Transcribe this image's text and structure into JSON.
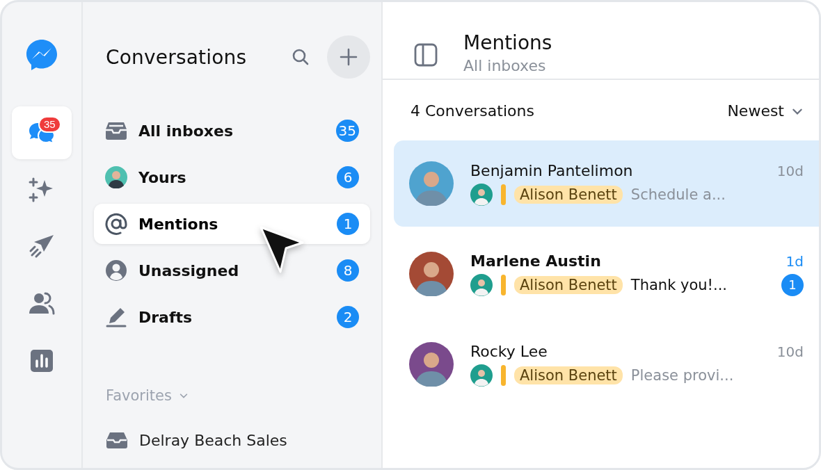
{
  "rail": {
    "items": [
      {
        "kind": "chats",
        "selected": true,
        "badge": "35"
      },
      {
        "kind": "sparkle",
        "selected": false
      },
      {
        "kind": "send",
        "selected": false
      },
      {
        "kind": "contacts",
        "selected": false
      },
      {
        "kind": "reports",
        "selected": false
      }
    ]
  },
  "sidebar": {
    "title": "Conversations",
    "items": [
      {
        "kind": "inbox",
        "label": "All inboxes",
        "count": "35",
        "selected": false
      },
      {
        "kind": "avatar",
        "label": "Yours",
        "count": "6",
        "selected": false
      },
      {
        "kind": "mention",
        "label": "Mentions",
        "count": "1",
        "selected": true
      },
      {
        "kind": "person",
        "label": "Unassigned",
        "count": "8",
        "selected": false
      },
      {
        "kind": "draft",
        "label": "Drafts",
        "count": "2",
        "selected": false
      }
    ],
    "favorites": {
      "label": "Favorites",
      "items": [
        {
          "label": "Delray Beach Sales"
        }
      ]
    }
  },
  "main": {
    "title": "Mentions",
    "subtitle": "All inboxes",
    "count_label": "4 Conversations",
    "sort": "Newest",
    "conversations": [
      {
        "name": "Benjamin Pantelimon",
        "time": "10d",
        "assignee": "Alison Benett",
        "preview": "Schedule a...",
        "selected": true,
        "unread": false
      },
      {
        "name": "Marlene Austin",
        "time": "1d",
        "assignee": "Alison Benett",
        "preview": "Thank you!...",
        "selected": false,
        "unread": true,
        "unread_count": "1"
      },
      {
        "name": "Rocky Lee",
        "time": "10d",
        "assignee": "Alison Benett",
        "preview": "Please provi...",
        "selected": false,
        "unread": false
      }
    ]
  }
}
